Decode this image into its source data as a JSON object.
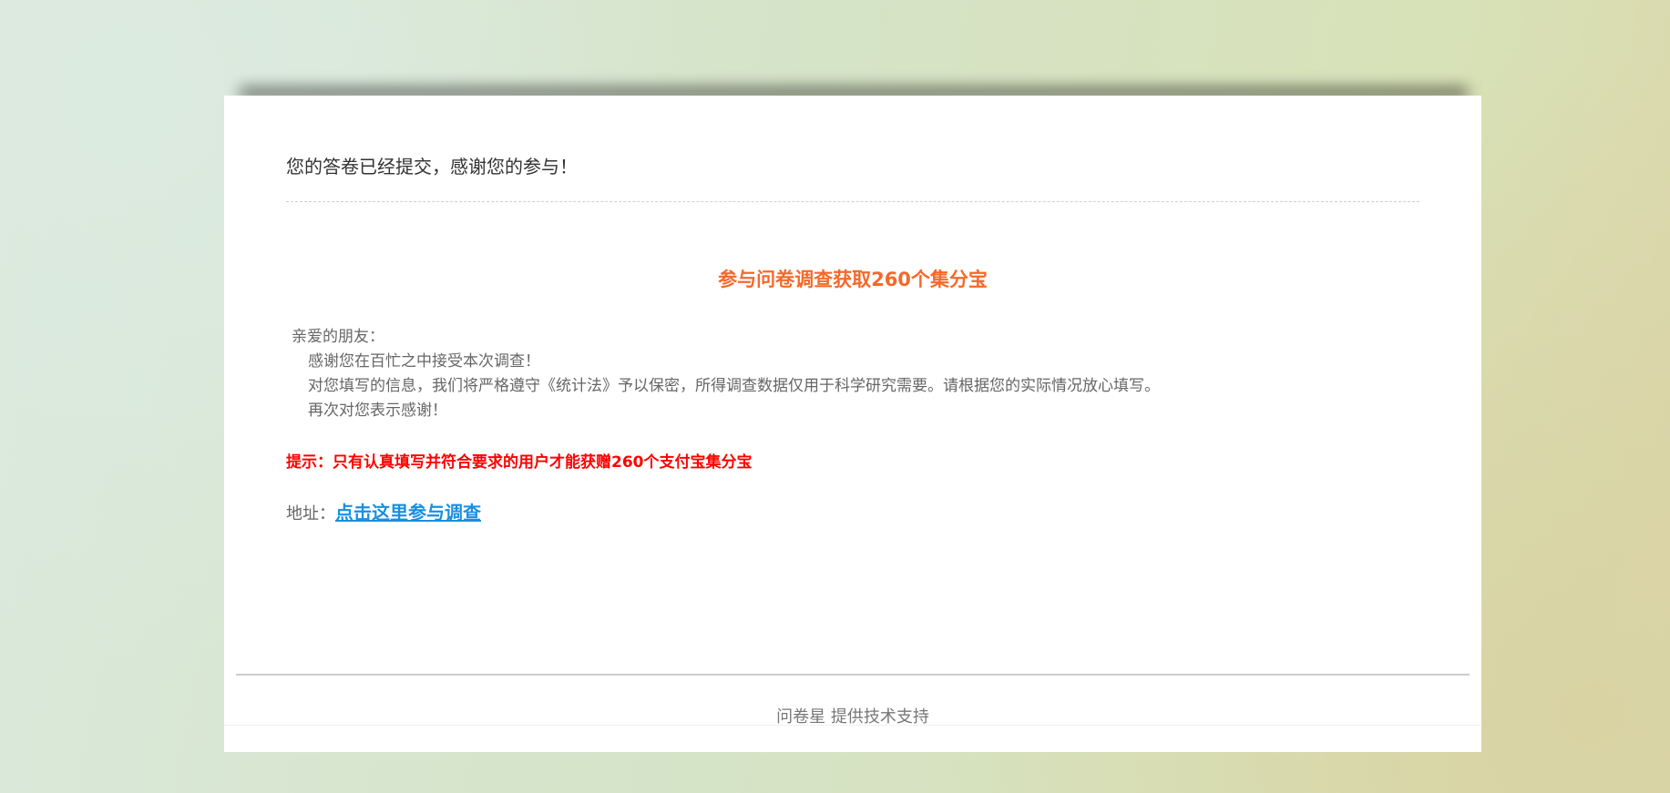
{
  "confirmation": {
    "message": "您的答卷已经提交，感谢您的参与！"
  },
  "promo": {
    "title": "参与问卷调查获取260个集分宝",
    "greeting": "亲爱的朋友：",
    "lines": [
      "感谢您在百忙之中接受本次调查！",
      "对您填写的信息，我们将严格遵守《统计法》予以保密，所得调查数据仅用于科学研究需要。请根据您的实际情况放心填写。",
      "再次对您表示感谢！"
    ],
    "tip": "提示：只有认真填写并符合要求的用户才能获赠260个支付宝集分宝",
    "address_label": "地址：",
    "link_text": "点击这里参与调查"
  },
  "footer": {
    "text": "问卷星 提供技术支持"
  },
  "colors": {
    "promo_title": "#f5692a",
    "tip": "#ff0000",
    "link": "#1a8fe0"
  }
}
